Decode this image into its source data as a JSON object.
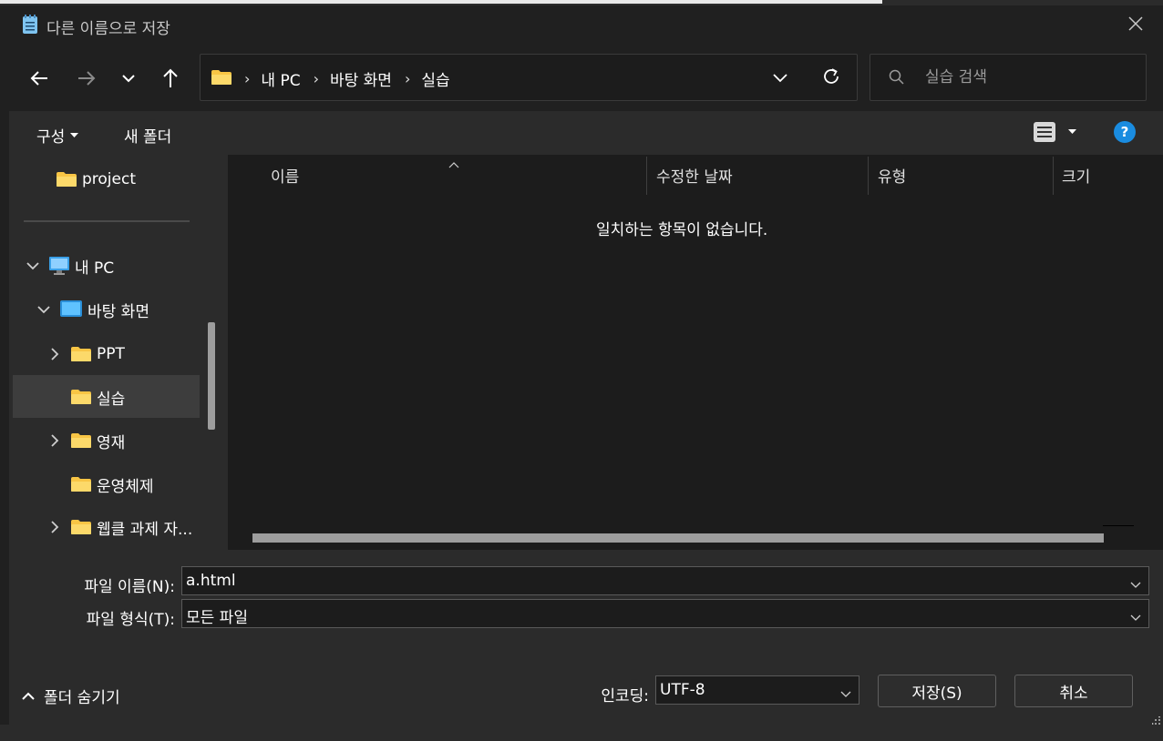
{
  "window": {
    "title": "다른 이름으로 저장"
  },
  "nav": {
    "breadcrumbs": [
      "내 PC",
      "바탕 화면",
      "실습"
    ],
    "search_placeholder": "실습 검색"
  },
  "toolbar": {
    "organize_label": "구성",
    "new_folder_label": "새 폴더",
    "help_label": "?"
  },
  "tree": {
    "items": [
      {
        "label": "project"
      },
      {
        "label": "내 PC"
      },
      {
        "label": "바탕 화면"
      },
      {
        "label": "PPT"
      },
      {
        "label": "실습"
      },
      {
        "label": "영재"
      },
      {
        "label": "운영체제"
      },
      {
        "label": "웹클 과제 자..."
      }
    ]
  },
  "list": {
    "columns": [
      "이름",
      "수정한 날짜",
      "유형",
      "크기"
    ],
    "empty_message": "일치하는 항목이 없습니다."
  },
  "form": {
    "filename_label": "파일 이름(N):",
    "filename_value": "a.html",
    "filetype_label": "파일 형식(T):",
    "filetype_value": "모든 파일",
    "encoding_label": "인코딩:",
    "encoding_value": "UTF-8",
    "save_label": "저장(S)",
    "cancel_label": "취소",
    "hide_folders_label": "폴더 숨기기"
  },
  "colors": {
    "folder": "#f8c545",
    "accent": "#1a8ce0"
  }
}
